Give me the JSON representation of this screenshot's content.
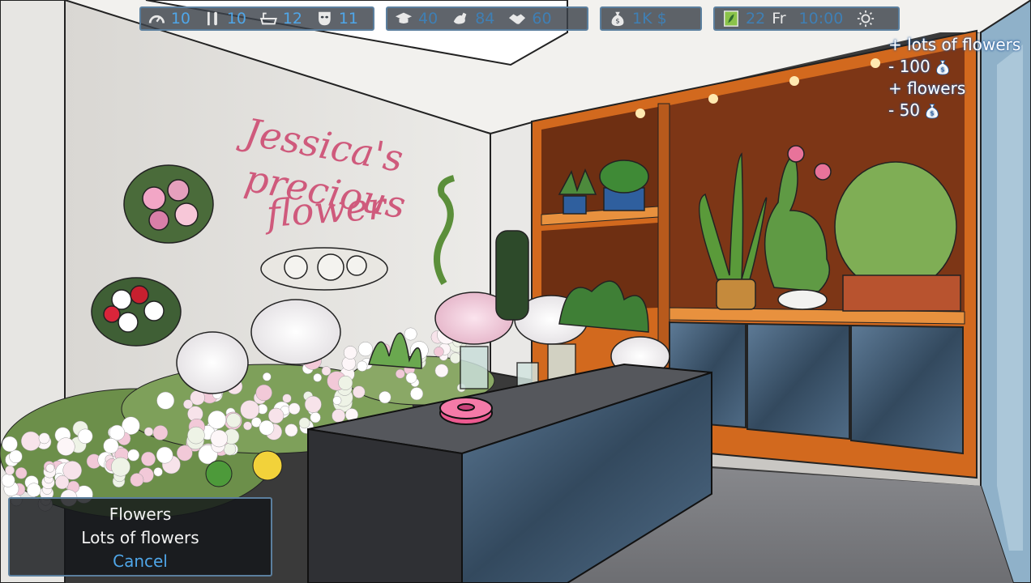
{
  "shop_sign": [
    "Jessica's",
    "precious",
    "flower"
  ],
  "hud": {
    "needs": {
      "energy": "10",
      "food": "10",
      "hygiene": "12",
      "mood": "11"
    },
    "skills": {
      "education": "40",
      "fitness": "84",
      "social": "60"
    },
    "money": "1K $",
    "calendar": {
      "day": "22",
      "weekday": "Fr",
      "time": "10:00"
    }
  },
  "notifications": [
    {
      "text": "+ lots of flowers",
      "icon": ""
    },
    {
      "text": "- 100",
      "icon": "money-bag-icon"
    },
    {
      "text": "+ flowers",
      "icon": ""
    },
    {
      "text": "- 50",
      "icon": "money-bag-icon"
    }
  ],
  "choice_menu": {
    "options": [
      "Flowers",
      "Lots of flowers"
    ],
    "cancel": "Cancel"
  },
  "colors": {
    "hud_text": "#4fa6e8",
    "hud_border": "#5b7f9e",
    "wood": "#d2691e",
    "counter": "#3b3d42"
  }
}
